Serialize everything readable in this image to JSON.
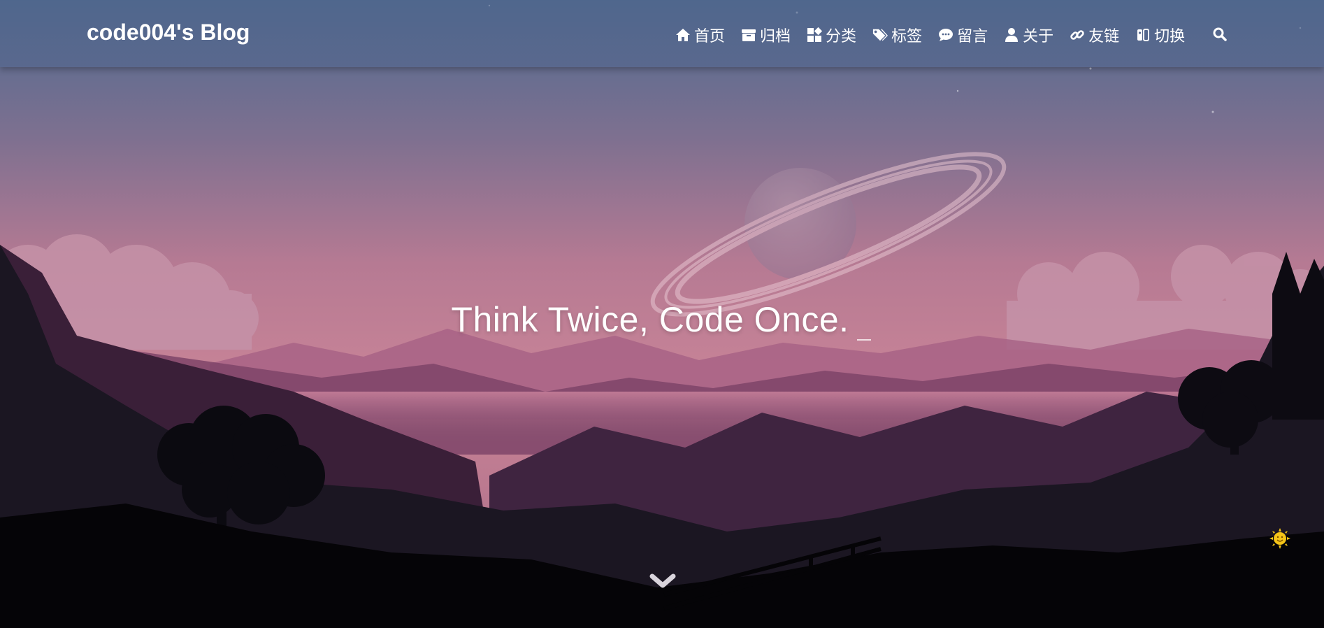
{
  "site": {
    "brand": "code004's Blog",
    "slogan": "Think Twice, Code Once."
  },
  "nav": {
    "items": [
      {
        "label": "首页",
        "icon": "home-icon"
      },
      {
        "label": "归档",
        "icon": "archive-icon"
      },
      {
        "label": "分类",
        "icon": "categories-icon"
      },
      {
        "label": "标签",
        "icon": "tags-icon"
      },
      {
        "label": "留言",
        "icon": "comment-icon"
      },
      {
        "label": "关于",
        "icon": "user-icon"
      },
      {
        "label": "友链",
        "icon": "link-icon"
      },
      {
        "label": "切换",
        "icon": "toggle-switch-icon"
      }
    ],
    "search_icon": "search-icon"
  },
  "controls": {
    "scroll_icon": "chevron-down-icon",
    "theme_icon": "sun-icon"
  },
  "colors": {
    "navbar": "#50648C",
    "sky_top": "#4E6A8E",
    "sky_pink": "#C98096",
    "text": "#FFFFFF",
    "sun": "#F5C518"
  }
}
